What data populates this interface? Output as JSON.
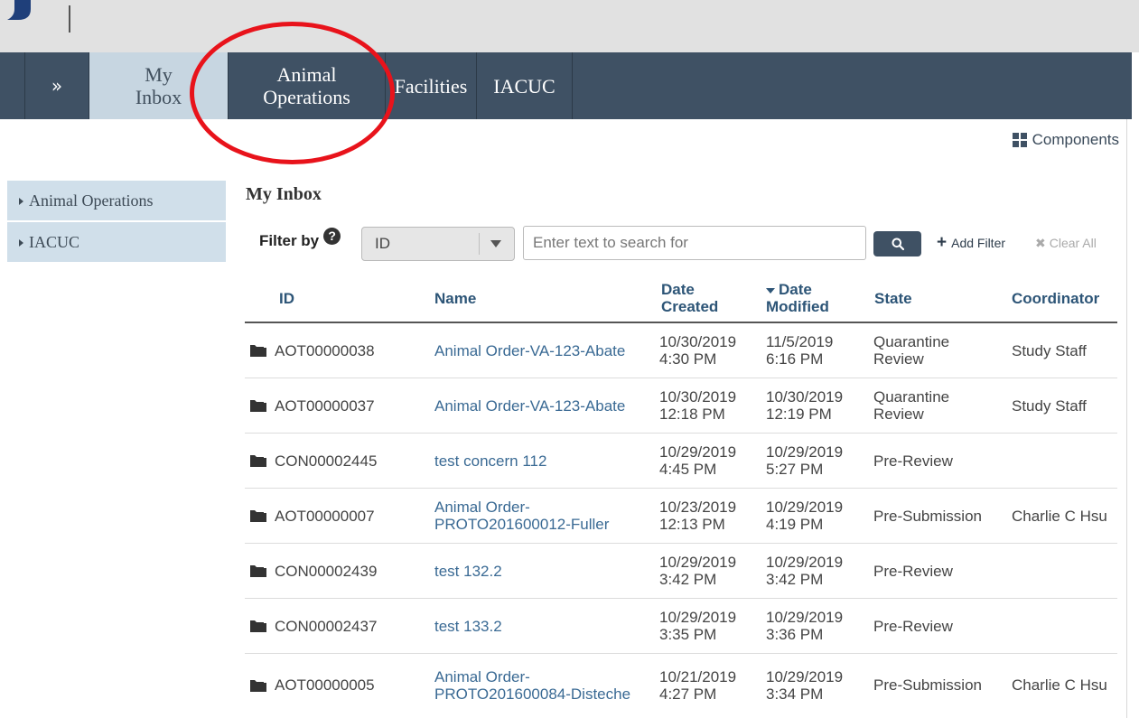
{
  "nav": {
    "collapse_glyph": "»",
    "tabs": [
      {
        "line1": "My",
        "line2": "Inbox"
      },
      {
        "line1": "Animal",
        "line2": "Operations"
      },
      {
        "line1": "Facilities",
        "line2": ""
      },
      {
        "line1": "IACUC",
        "line2": ""
      }
    ]
  },
  "components_label": "Components",
  "sidebar": {
    "items": [
      {
        "label": "Animal Operations"
      },
      {
        "label": "IACUC"
      }
    ]
  },
  "inbox": {
    "title": "My Inbox",
    "filter_label": "Filter by",
    "help_glyph": "?",
    "filter_select_value": "ID",
    "search_placeholder": "Enter text to search for",
    "add_filter_label": "Add Filter",
    "add_filter_glyph": "+",
    "clear_all_label": "Clear All",
    "clear_all_glyph": "✖"
  },
  "table": {
    "columns": {
      "id": "ID",
      "name": "Name",
      "date_created_1": "Date",
      "date_created_2": "Created",
      "date_modified_1": "Date",
      "date_modified_2": "Modified",
      "state": "State",
      "coordinator": "Coordinator"
    },
    "rows": [
      {
        "id": "AOT00000038",
        "name": "Animal Order-VA-123-Abate",
        "created_date": "10/30/2019",
        "created_time": "4:30 PM",
        "modified_date": "11/5/2019",
        "modified_time": "6:16 PM",
        "state": "Quarantine Review",
        "coordinator": "Study Staff"
      },
      {
        "id": "AOT00000037",
        "name": "Animal Order-VA-123-Abate",
        "created_date": "10/30/2019",
        "created_time": "12:18 PM",
        "modified_date": "10/30/2019",
        "modified_time": "12:19 PM",
        "state": "Quarantine Review",
        "coordinator": "Study Staff"
      },
      {
        "id": "CON00002445",
        "name": "test concern 112",
        "created_date": "10/29/2019",
        "created_time": "4:45 PM",
        "modified_date": "10/29/2019",
        "modified_time": "5:27 PM",
        "state": "Pre-Review",
        "coordinator": ""
      },
      {
        "id": "AOT00000007",
        "name": "Animal Order-PROTO201600012-Fuller",
        "created_date": "10/23/2019",
        "created_time": "12:13 PM",
        "modified_date": "10/29/2019",
        "modified_time": "4:19 PM",
        "state": "Pre-Submission",
        "coordinator": "Charlie C Hsu"
      },
      {
        "id": "CON00002439",
        "name": "test 132.2",
        "created_date": "10/29/2019",
        "created_time": "3:42 PM",
        "modified_date": "10/29/2019",
        "modified_time": "3:42 PM",
        "state": "Pre-Review",
        "coordinator": ""
      },
      {
        "id": "CON00002437",
        "name": "test 133.2",
        "created_date": "10/29/2019",
        "created_time": "3:35 PM",
        "modified_date": "10/29/2019",
        "modified_time": "3:36 PM",
        "state": "Pre-Review",
        "coordinator": ""
      },
      {
        "id": "AOT00000005",
        "name": "Animal Order-PROTO201600084-Disteche",
        "created_date": "10/21/2019",
        "created_time": "4:27 PM",
        "modified_date": "10/29/2019",
        "modified_time": "3:34 PM",
        "state": "Pre-Submission",
        "coordinator": "Charlie C Hsu"
      }
    ]
  },
  "colors": {
    "nav_bg": "#3f5164",
    "active_tab_bg": "#c7d6e1",
    "sidebar_bg": "#d0dfea",
    "link": "#3a6a94",
    "highlight_ring": "#e8131b"
  }
}
